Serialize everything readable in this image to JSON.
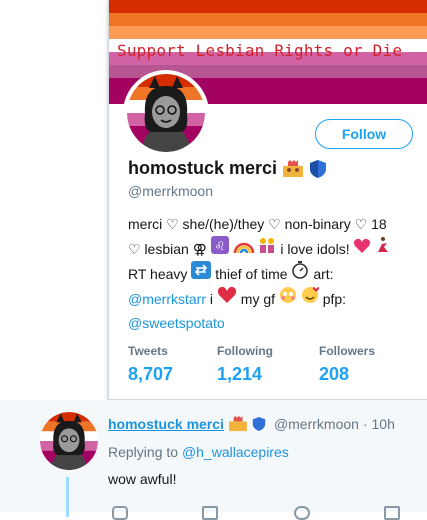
{
  "banner": {
    "text": "Support Lesbian Rights or Die",
    "stripe_colors": [
      "#d52d00",
      "#ef7627",
      "#ff9a56",
      "#ffffff",
      "#d162a4",
      "#b55690",
      "#a30262"
    ]
  },
  "profile": {
    "display_name": "homostuck merci",
    "handle": "@merrkmoon",
    "follow_label": "Follow",
    "bio": {
      "line1": "merci ♡ she/(he)/they ♡ non-binary ♡ 18",
      "line2_a": "♡ lesbian ⚢",
      "line2_b": "i love idols!",
      "line3_a": "RT heavy",
      "line3_b": "thief of time",
      "line3_c": "art:",
      "line4_link": "@merrkstarr",
      "line4_a": "i",
      "line4_b": "my gf",
      "line4_c": "pfp:",
      "line5_link": "@sweetspotato"
    },
    "stats": [
      {
        "label": "Tweets",
        "value": "8,707"
      },
      {
        "label": "Following",
        "value": "1,214"
      },
      {
        "label": "Followers",
        "value": "208"
      }
    ]
  },
  "tweet": {
    "display_name": "homostuck merci",
    "handle": "@merrkmoon",
    "time": "· 10h",
    "replying_prefix": "Replying to",
    "replying_to": "@h_wallacepires",
    "text": "wow awful!"
  },
  "colors": {
    "accent": "#1da1f2",
    "link": "#1b95e0",
    "muted": "#657786"
  }
}
